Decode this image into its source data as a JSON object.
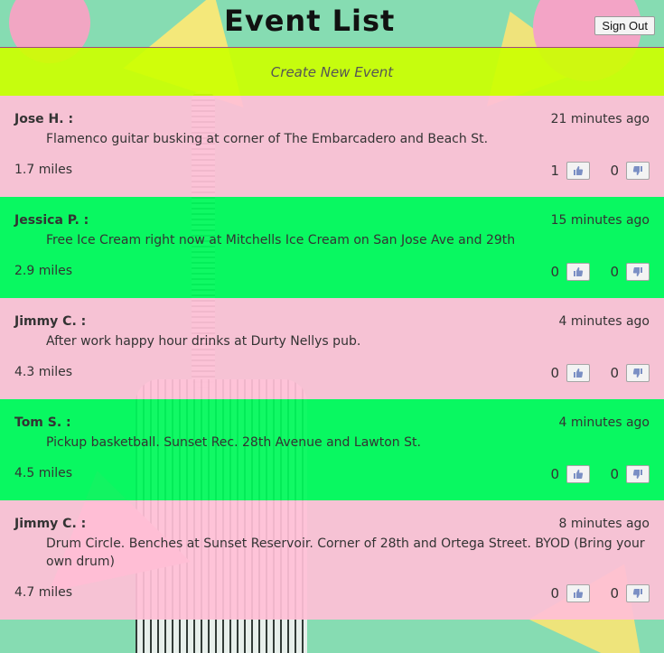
{
  "header": {
    "title": "Event List",
    "sign_out_label": "Sign Out"
  },
  "create_event_label": "Create New Event",
  "events": [
    {
      "author": "Jose H. :",
      "time_ago": "21 minutes ago",
      "description": "Flamenco guitar busking at corner of The Embarcadero and Beach St.",
      "distance": "1.7 miles",
      "likes": "1",
      "dislikes": "0",
      "color": "pink"
    },
    {
      "author": "Jessica P. :",
      "time_ago": "15 minutes ago",
      "description": "Free Ice Cream right now at Mitchells Ice Cream on San Jose Ave and 29th",
      "distance": "2.9 miles",
      "likes": "0",
      "dislikes": "0",
      "color": "green"
    },
    {
      "author": "Jimmy C. :",
      "time_ago": "4 minutes ago",
      "description": "After work happy hour drinks at Durty Nellys pub.",
      "distance": "4.3 miles",
      "likes": "0",
      "dislikes": "0",
      "color": "pink"
    },
    {
      "author": "Tom S. :",
      "time_ago": "4 minutes ago",
      "description": "Pickup basketball. Sunset Rec. 28th Avenue and Lawton St.",
      "distance": "4.5 miles",
      "likes": "0",
      "dislikes": "0",
      "color": "green"
    },
    {
      "author": "Jimmy C. :",
      "time_ago": "8 minutes ago",
      "description": "Drum Circle. Benches at Sunset Reservoir. Corner of 28th and Ortega Street. BYOD (Bring your own drum)",
      "distance": "4.7 miles",
      "likes": "0",
      "dislikes": "0",
      "color": "pink"
    }
  ],
  "colors": {
    "pink_row": "#ffc0d6",
    "green_row": "#00fa5a",
    "create_bar": "#ccff00"
  },
  "icons": {
    "like": "thumbs-up-icon",
    "dislike": "thumbs-down-icon"
  }
}
